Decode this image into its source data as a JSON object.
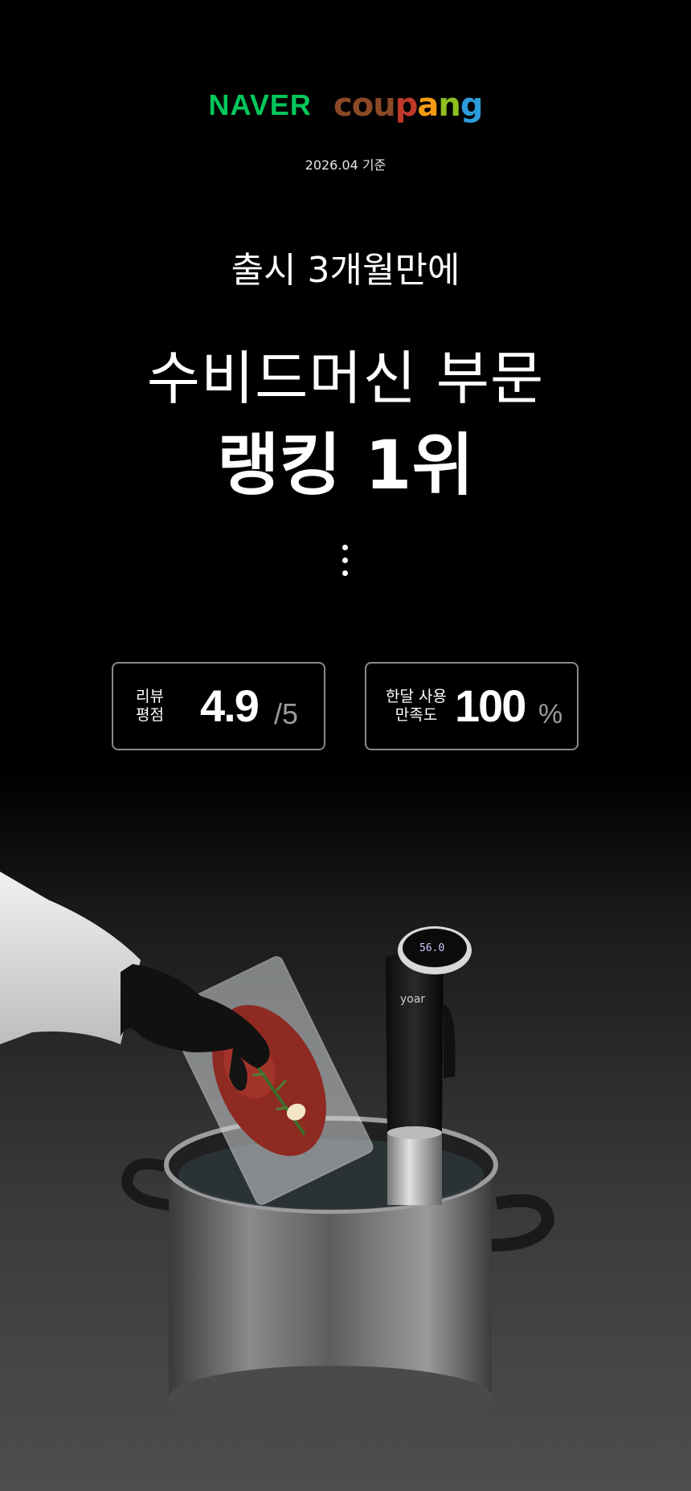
{
  "logos": {
    "naver": "NAVER",
    "coupang_letters": [
      {
        "ch": "c",
        "color": "#8b4a26"
      },
      {
        "ch": "o",
        "color": "#8b4a26"
      },
      {
        "ch": "u",
        "color": "#8b4a26"
      },
      {
        "ch": "p",
        "color": "#c0392b"
      },
      {
        "ch": "a",
        "color": "#f39c12"
      },
      {
        "ch": "n",
        "color": "#8fbf21"
      },
      {
        "ch": "g",
        "color": "#2d9cdb"
      }
    ],
    "coupang": "coupang"
  },
  "basis_date": "2026.04 기준",
  "subtitle": "출시 3개월만에",
  "headline_line1": "수비드머신 부문",
  "headline_line2": "랭킹 1위",
  "stats": {
    "review": {
      "label_line1": "리뷰",
      "label_line2": "평점",
      "value": "4.9",
      "unit": "/5"
    },
    "satisfaction": {
      "label_line1": "한달 사용",
      "label_line2": "만족도",
      "value": "100",
      "unit": "%"
    }
  },
  "product_image": {
    "brand_on_device": "yoar",
    "description_icon": "sous-vide-pot-photo"
  },
  "colors": {
    "naver_green": "#03c75a",
    "background": "#000000",
    "border": "#8a8a8a"
  }
}
